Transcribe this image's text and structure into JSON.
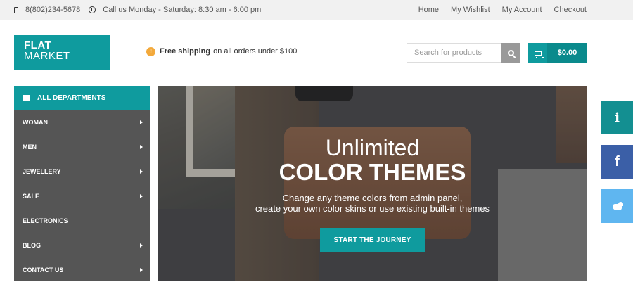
{
  "topbar": {
    "phone": "8(802)234-5678",
    "hours": "Call us Monday - Saturday: 8:30 am - 6:00 pm",
    "links": [
      "Home",
      "My Wishlist",
      "My Account",
      "Checkout"
    ]
  },
  "logo": {
    "line1": "FLAT",
    "line2": "MARKET"
  },
  "shipping": {
    "bold": "Free shipping",
    "rest": "on all orders under $100"
  },
  "search": {
    "placeholder": "Search for products"
  },
  "cart": {
    "total": "$0.00"
  },
  "sidebar": {
    "header": "ALL DEPARTMENTS",
    "items": [
      {
        "label": "WOMAN",
        "has_submenu": true
      },
      {
        "label": "MEN",
        "has_submenu": true
      },
      {
        "label": "JEWELLERY",
        "has_submenu": true
      },
      {
        "label": "SALE",
        "has_submenu": true
      },
      {
        "label": "ELECTRONICS",
        "has_submenu": false
      },
      {
        "label": "BLOG",
        "has_submenu": true
      },
      {
        "label": "CONTACT US",
        "has_submenu": true
      }
    ]
  },
  "hero": {
    "title_line1": "Unlimited",
    "title_line2": "COLOR THEMES",
    "subtitle_line1": "Change any theme colors from admin panel,",
    "subtitle_line2": "create your own color skins or use existing built-in themes",
    "cta": "START THE JOURNEY"
  },
  "social": {
    "info_glyph": "i",
    "facebook_glyph": "f"
  },
  "colors": {
    "accent": "#0f9b9e",
    "sidebar": "#555555",
    "facebook": "#3b5fa7",
    "twitter": "#5fb6f0",
    "notice": "#f3a93b"
  }
}
